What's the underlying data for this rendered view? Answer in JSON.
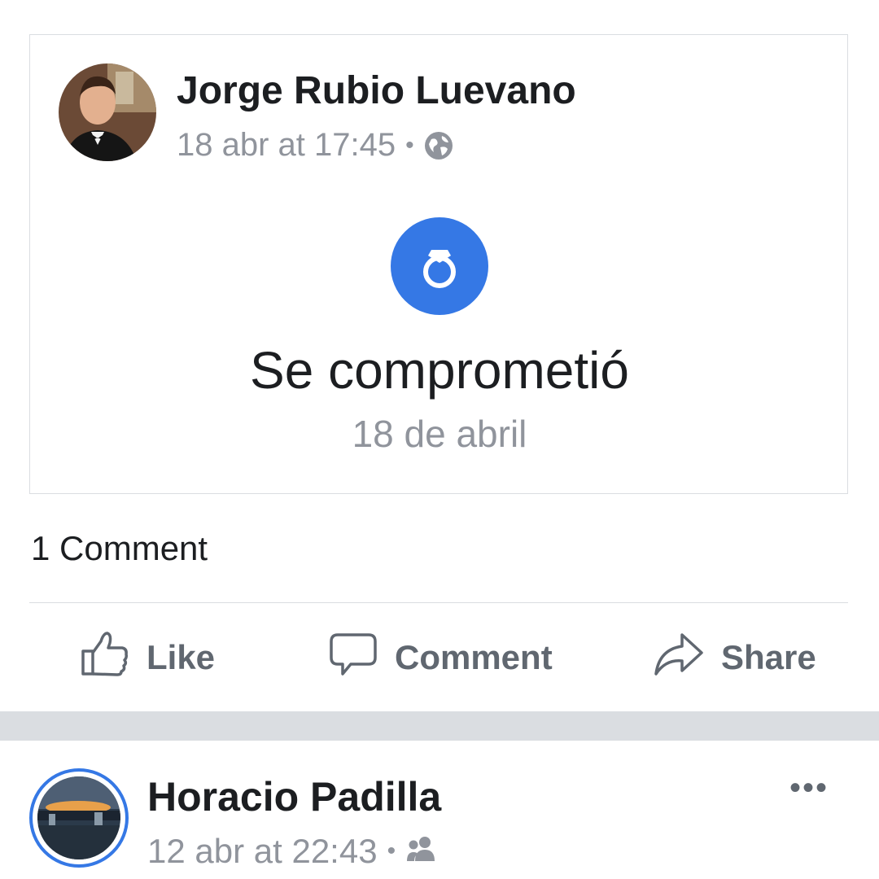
{
  "post": {
    "author": "Jorge Rubio Luevano",
    "timestamp": "18 abr at 17:45",
    "separator": "•",
    "privacy_icon": "globe-icon",
    "event": {
      "icon": "ring-icon",
      "title": "Se comprometió",
      "date": "18 de abril"
    },
    "comment_count": "1 Comment"
  },
  "actions": {
    "like": "Like",
    "comment": "Comment",
    "share": "Share"
  },
  "next_post": {
    "author": "Horacio Padilla",
    "timestamp": "12 abr at 22:43",
    "separator": "•",
    "privacy_icon": "friends-icon",
    "more_label": "•••"
  },
  "colors": {
    "accent": "#3578e5",
    "text_primary": "#1c1e21",
    "text_secondary": "#90949c",
    "divider": "#dadde1"
  }
}
